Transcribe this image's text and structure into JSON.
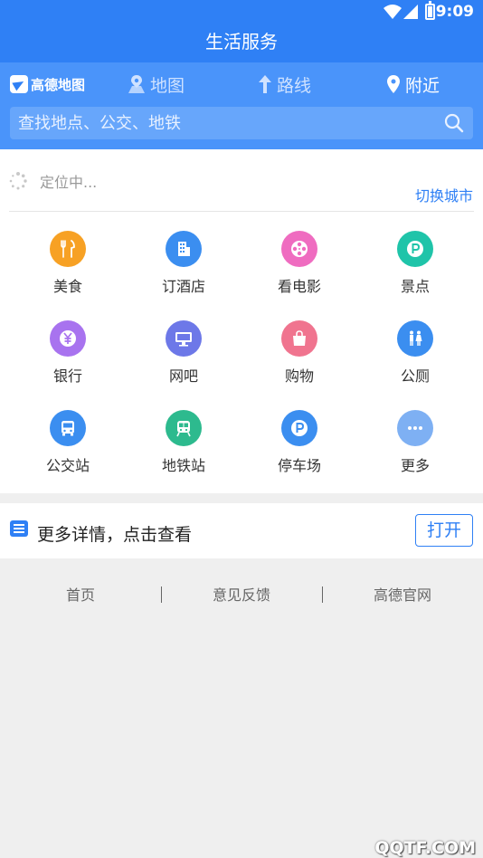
{
  "status_bar": {
    "time": "9:09"
  },
  "title_bar": {
    "title": "生活服务"
  },
  "amap": {
    "logo_text": "高德地图",
    "tabs": [
      {
        "label": "地图",
        "icon": "map-icon"
      },
      {
        "label": "路线",
        "icon": "route-arrow-icon"
      },
      {
        "label": "附近",
        "icon": "location-pin-icon",
        "active": true
      }
    ],
    "search": {
      "placeholder": "查找地点、公交、地铁",
      "value": ""
    }
  },
  "location": {
    "status": "定位中...",
    "switch_city": "切换城市"
  },
  "categories": [
    {
      "label": "美食",
      "icon": "fork-knife-icon",
      "color": "#f7a124"
    },
    {
      "label": "订酒店",
      "icon": "hotel-icon",
      "color": "#3b8ef0"
    },
    {
      "label": "看电影",
      "icon": "film-reel-icon",
      "color": "#ef6cc0"
    },
    {
      "label": "景点",
      "icon": "scenic-spot-icon",
      "color": "#1fc4a9"
    },
    {
      "label": "银行",
      "icon": "yuan-icon",
      "color": "#a873ef"
    },
    {
      "label": "网吧",
      "icon": "monitor-icon",
      "color": "#6d78e8"
    },
    {
      "label": "购物",
      "icon": "shopping-bag-icon",
      "color": "#f0748f"
    },
    {
      "label": "公厕",
      "icon": "restroom-icon",
      "color": "#3b8ef0"
    },
    {
      "label": "公交站",
      "icon": "bus-icon",
      "color": "#3b8ef0"
    },
    {
      "label": "地铁站",
      "icon": "subway-icon",
      "color": "#2dba8e"
    },
    {
      "label": "停车场",
      "icon": "parking-icon",
      "color": "#3b8ef0"
    },
    {
      "label": "更多",
      "icon": "more-dots-icon",
      "color": "#7eb0f3"
    }
  ],
  "details": {
    "text": "更多详情，点击查看",
    "button_label": "打开"
  },
  "footer": {
    "links": [
      "首页",
      "意见反馈",
      "高德官网"
    ]
  },
  "watermark": "QQTF.COM",
  "colors": {
    "primary": "#2f80f5",
    "header": "#4a94fa"
  }
}
